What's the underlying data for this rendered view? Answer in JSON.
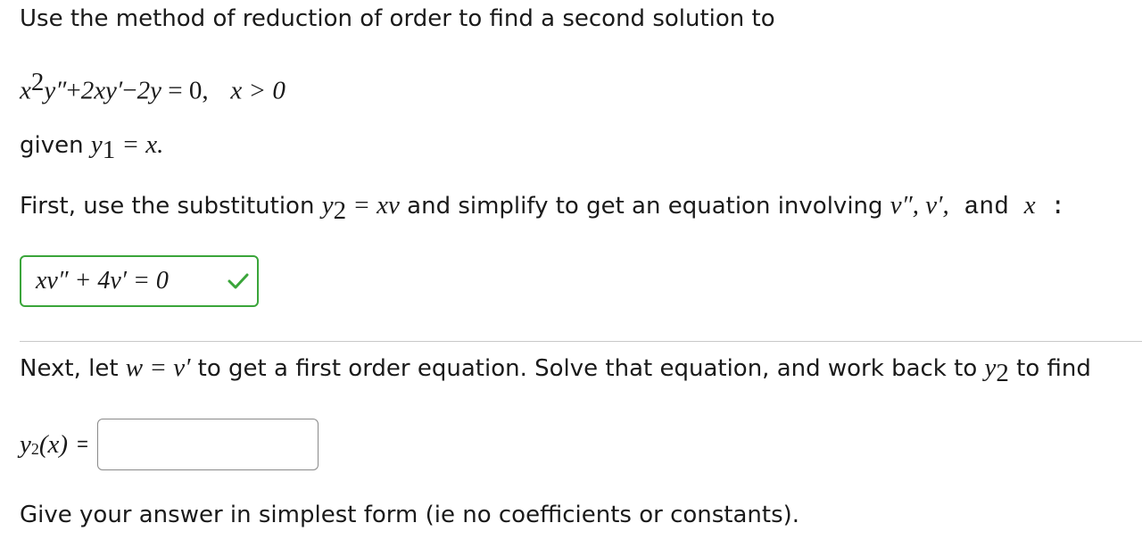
{
  "prompt": "Use the method of reduction of order to find a second solution to",
  "equation": {
    "lhs_term1_base": "x",
    "lhs_term1_exp": "2",
    "lhs_term1_rest": "y″",
    "plus1": "+",
    "term2": "2xy′",
    "minus1": "−",
    "term3": "2y",
    "eq": " = 0,",
    "condition": "x > 0"
  },
  "given": {
    "text": "given ",
    "y": "y",
    "sub": "1",
    "rest": " = x."
  },
  "first_step": {
    "text_before": "First, use the substitution ",
    "y": "y",
    "sub": "2",
    "sub_eq": " = xv",
    "text_after": " and simplify to get an equation involving ",
    "vars": "v″,  v′,",
    "and": " and ",
    "x": "x",
    "colon": " :"
  },
  "first_answer": {
    "value": "xv″ + 4v′ = 0",
    "status": "correct",
    "status_color": "#3aa53a",
    "check_icon": "checkmark-icon"
  },
  "next_step": {
    "text_before": "Next, let ",
    "w_eq": "w = v′",
    "text_mid": " to get a first order equation. Solve that equation, and work back to ",
    "y": "y",
    "sub": "2",
    "text_after": " to find"
  },
  "y2_answer": {
    "label_y": "y",
    "label_sub": "2",
    "label_arg": "(x)",
    "equals": "=",
    "value": "",
    "placeholder": ""
  },
  "instruction": "Give your answer in simplest form (ie no coefficients or constants)."
}
